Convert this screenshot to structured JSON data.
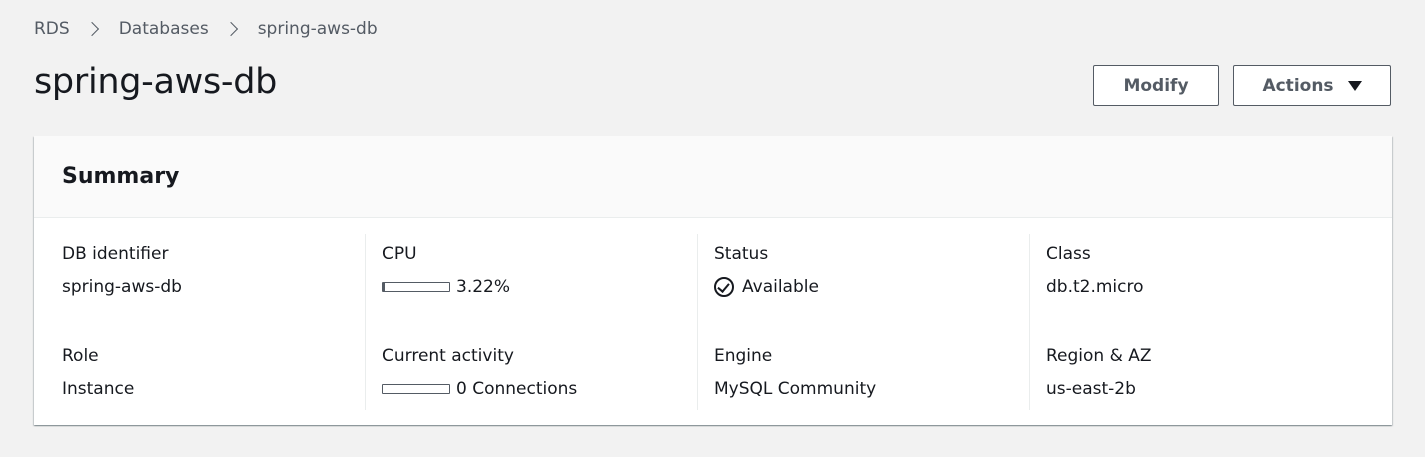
{
  "breadcrumb": {
    "items": [
      "RDS",
      "Databases",
      "spring-aws-db"
    ]
  },
  "page": {
    "title": "spring-aws-db"
  },
  "buttons": {
    "modify": "Modify",
    "actions": "Actions"
  },
  "summary": {
    "title": "Summary",
    "db_identifier": {
      "label": "DB identifier",
      "value": "spring-aws-db"
    },
    "role": {
      "label": "Role",
      "value": "Instance"
    },
    "cpu": {
      "label": "CPU",
      "value": "3.22%",
      "fraction": 0.0322
    },
    "current_activity": {
      "label": "Current activity",
      "value": "0 Connections",
      "fraction": 0
    },
    "status": {
      "label": "Status",
      "value": "Available",
      "icon": "check-circle-icon"
    },
    "engine": {
      "label": "Engine",
      "value": "MySQL Community"
    },
    "class": {
      "label": "Class",
      "value": "db.t2.micro"
    },
    "region_az": {
      "label": "Region & AZ",
      "value": "us-east-2b"
    }
  }
}
